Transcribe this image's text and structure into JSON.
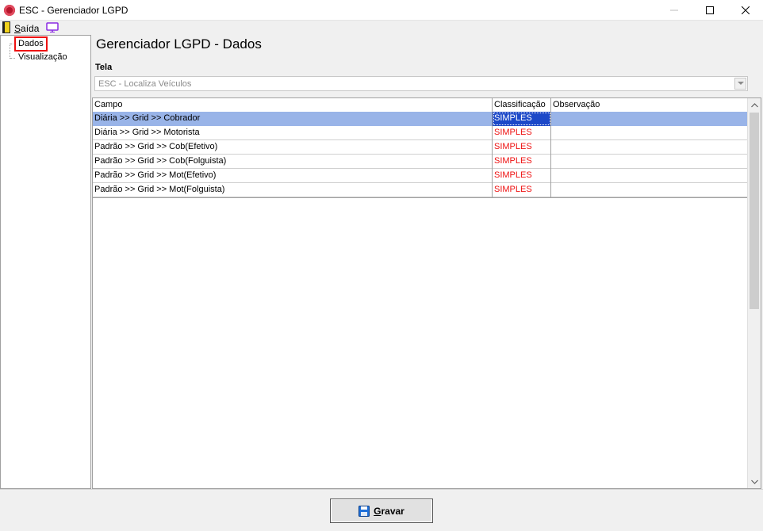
{
  "window": {
    "title": "ESC - Gerenciador LGPD"
  },
  "menu": {
    "exit_label_underlined": "S",
    "exit_label_rest": "aída"
  },
  "tree": {
    "items": [
      {
        "label": "Dados",
        "selected": true
      },
      {
        "label": "Visualização",
        "selected": false
      }
    ]
  },
  "main": {
    "page_title": "Gerenciador LGPD - Dados",
    "screen_label": "Tela",
    "screen_select_value": "ESC - Localiza Veículos"
  },
  "grid": {
    "columns": [
      "Campo",
      "Classificação",
      "Observação"
    ],
    "rows": [
      {
        "campo": "Diária >> Grid >> Cobrador",
        "classificacao": "SIMPLES",
        "observacao": ""
      },
      {
        "campo": "Diária >> Grid >> Motorista",
        "classificacao": "SIMPLES",
        "observacao": ""
      },
      {
        "campo": "Padrão >> Grid >> Cob(Efetivo)",
        "classificacao": "SIMPLES",
        "observacao": ""
      },
      {
        "campo": "Padrão >> Grid >> Cob(Folguista)",
        "classificacao": "SIMPLES",
        "observacao": ""
      },
      {
        "campo": "Padrão >> Grid >> Mot(Efetivo)",
        "classificacao": "SIMPLES",
        "observacao": ""
      },
      {
        "campo": "Padrão >> Grid >> Mot(Folguista)",
        "classificacao": "SIMPLES",
        "observacao": ""
      }
    ],
    "selected_row": 0
  },
  "footer": {
    "save_label_underlined": "G",
    "save_label_rest": "ravar"
  },
  "colors": {
    "classification_text": "#ee1111",
    "selected_row": "#99b4e8",
    "selected_cell": "#1c48c8",
    "tree_highlight_border": "#ee1111"
  },
  "icons": {
    "app": "app-logo-icon",
    "exit": "exit-door-icon",
    "monitor": "monitor-icon",
    "save": "floppy-disk-icon"
  }
}
